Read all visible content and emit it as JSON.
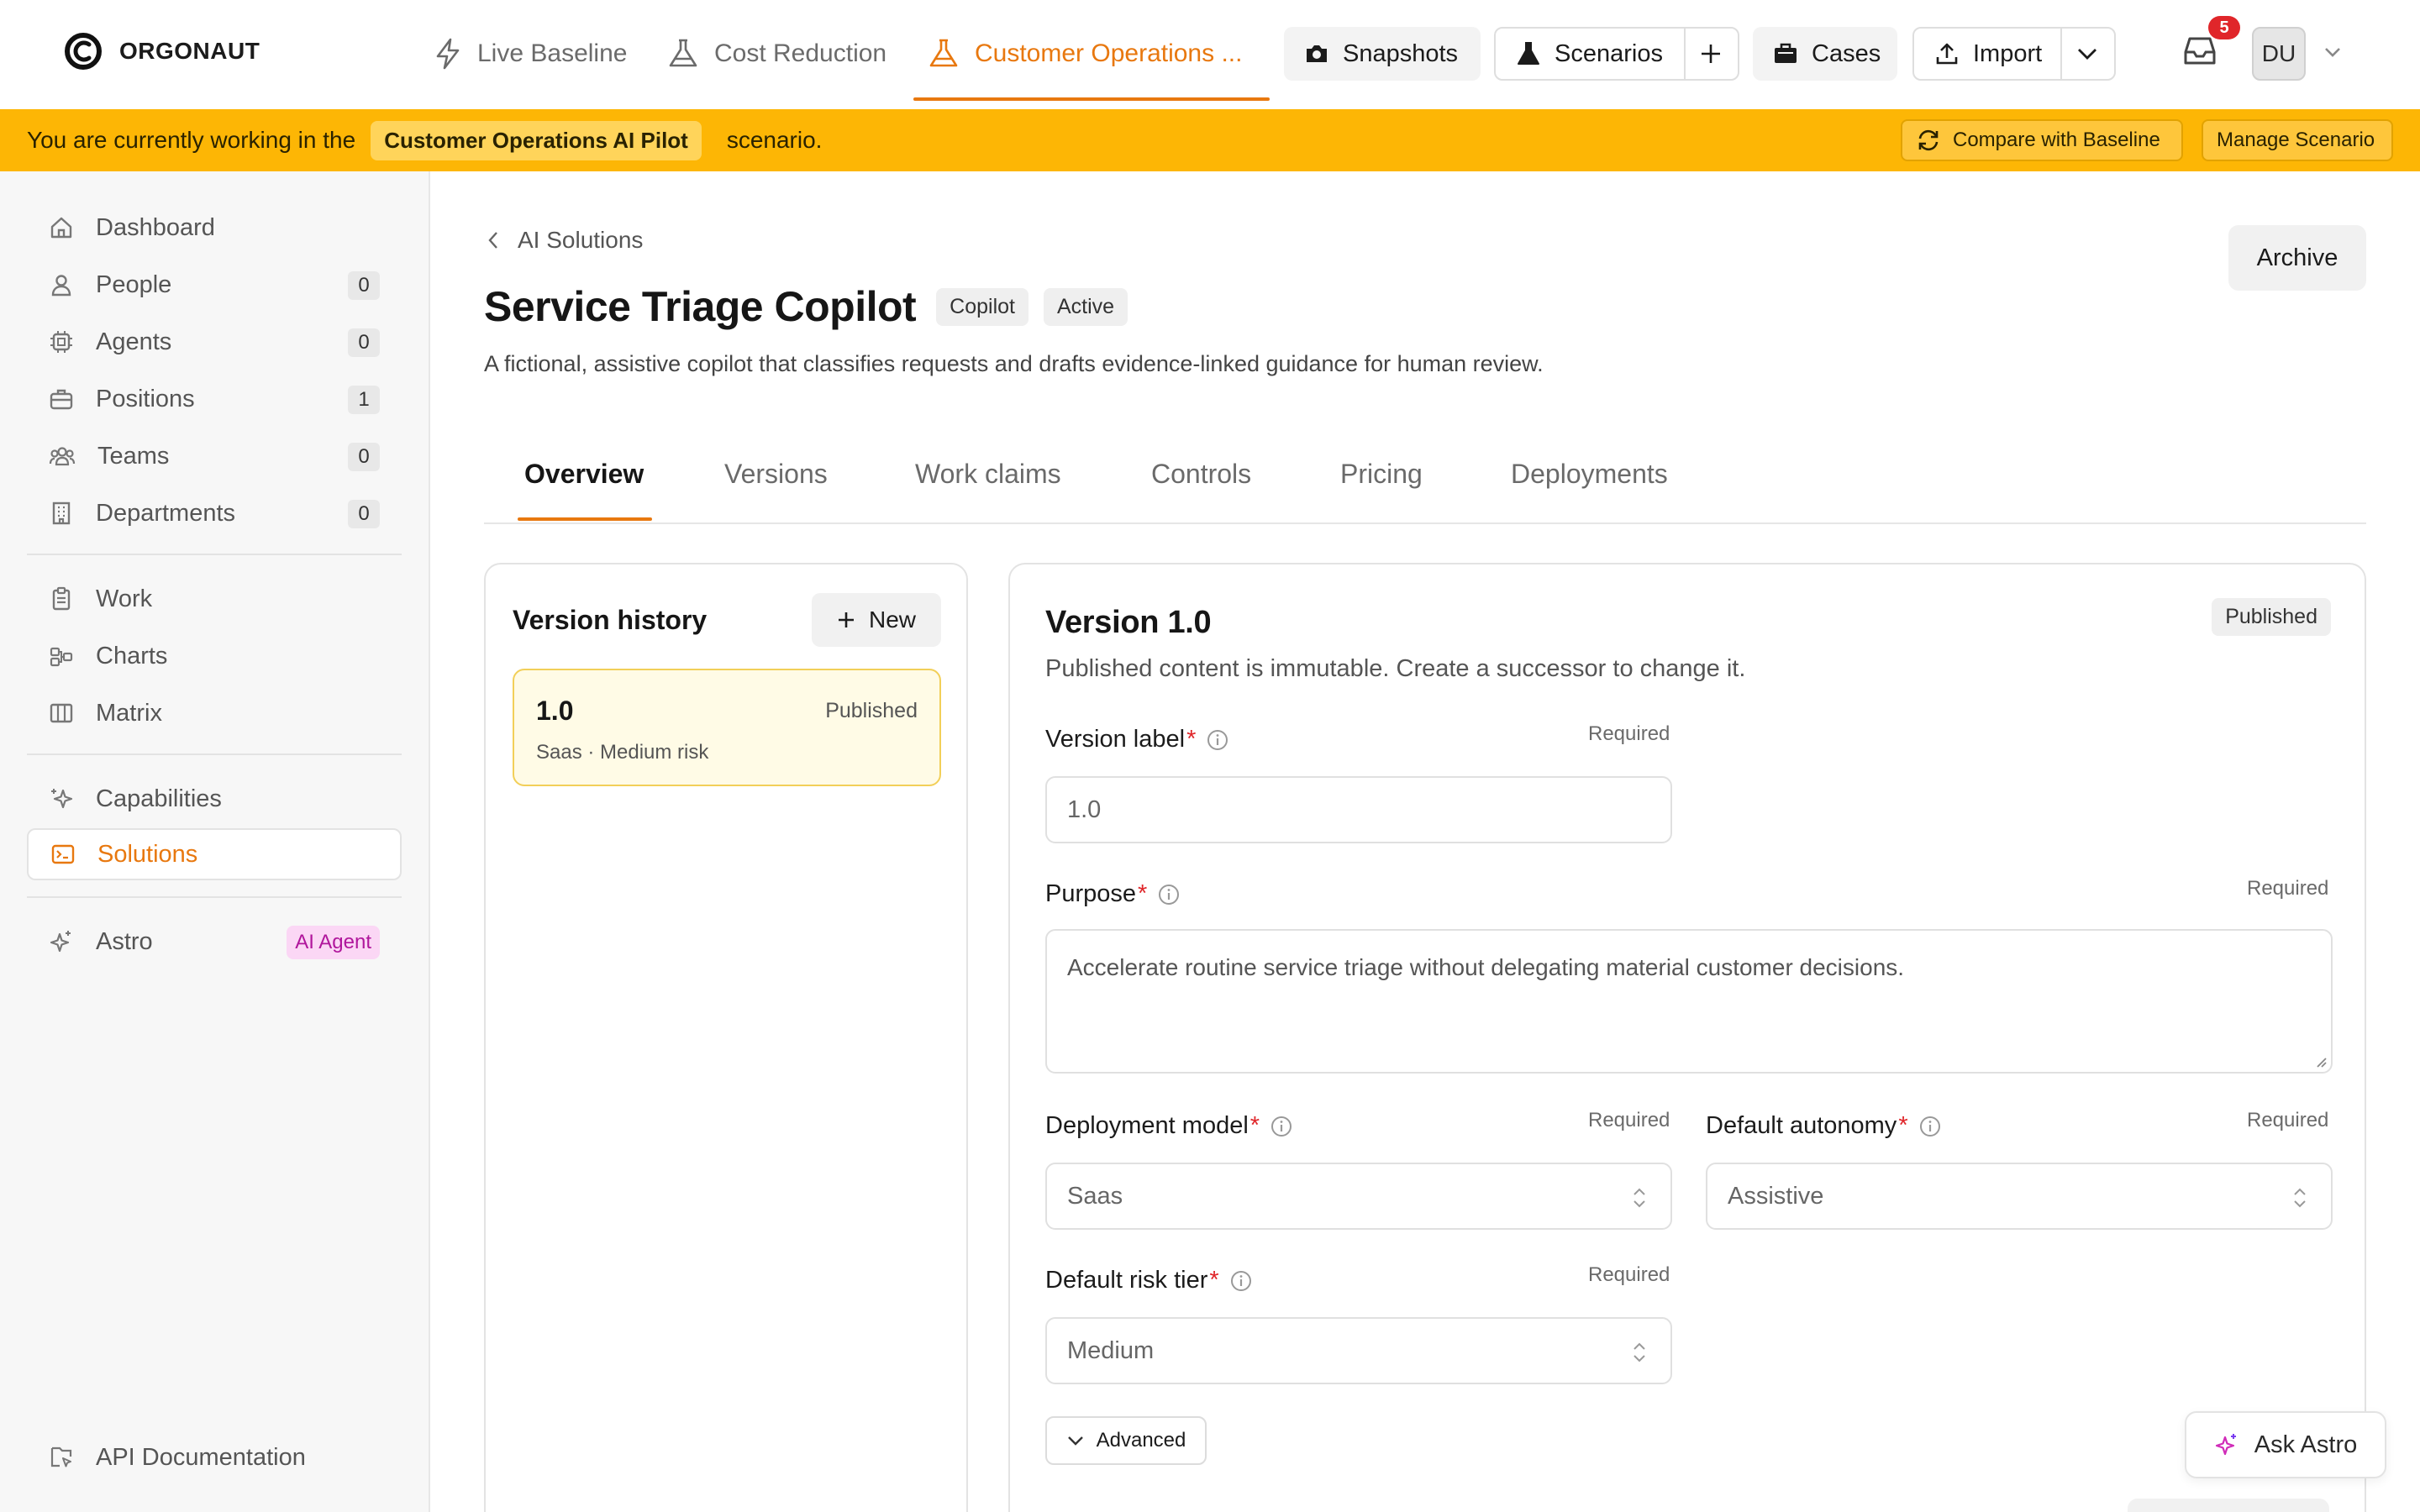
{
  "app": {
    "name": "ORGONAUT"
  },
  "nav": {
    "tabs": [
      {
        "label": "Live Baseline",
        "icon": "bolt-icon"
      },
      {
        "label": "Cost Reduction",
        "icon": "flask-icon"
      },
      {
        "label": "Customer Operations ...",
        "icon": "flask-icon",
        "active": true
      }
    ],
    "buttons": {
      "snapshots": "Snapshots",
      "scenarios": "Scenarios",
      "cases": "Cases",
      "import": "Import"
    },
    "inbox_count": "5",
    "user_initials": "DU"
  },
  "banner": {
    "prefix": "You are currently working in the",
    "scenario_name": "Customer Operations AI Pilot",
    "suffix": "scenario.",
    "compare_button": "Compare with Baseline",
    "manage_button": "Manage Scenario"
  },
  "sidebar": {
    "items": [
      {
        "label": "Dashboard"
      },
      {
        "label": "People",
        "count": "0"
      },
      {
        "label": "Agents",
        "count": "0"
      },
      {
        "label": "Positions",
        "count": "1"
      },
      {
        "label": "Teams",
        "count": "0"
      },
      {
        "label": "Departments",
        "count": "0"
      },
      {
        "label": "Work"
      },
      {
        "label": "Charts"
      },
      {
        "label": "Matrix"
      },
      {
        "label": "Capabilities"
      },
      {
        "label": "Solutions",
        "active": true
      },
      {
        "label": "Astro",
        "badge": "AI Agent"
      },
      {
        "label": "API Documentation"
      }
    ]
  },
  "page": {
    "breadcrumb": "AI Solutions",
    "title": "Service Triage Copilot",
    "tags": [
      "Copilot",
      "Active"
    ],
    "description": "A fictional, assistive copilot that classifies requests and drafts evidence-linked guidance for human review.",
    "archive_button": "Archive",
    "tabs": [
      "Overview",
      "Versions",
      "Work claims",
      "Controls",
      "Pricing",
      "Deployments"
    ],
    "active_tab": "Overview"
  },
  "version_history": {
    "title": "Version history",
    "new_button": "New",
    "items": [
      {
        "version": "1.0",
        "status": "Published",
        "meta": "Saas · Medium risk"
      }
    ]
  },
  "version_detail": {
    "title": "Version 1.0",
    "status": "Published",
    "note": "Published content is immutable. Create a successor to change it.",
    "required_text": "Required",
    "fields": {
      "version_label": {
        "label": "Version label",
        "value": "1.0"
      },
      "purpose": {
        "label": "Purpose",
        "value": "Accelerate routine service triage without delegating material customer decisions."
      },
      "deployment_model": {
        "label": "Deployment model",
        "value": "Saas"
      },
      "default_autonomy": {
        "label": "Default autonomy",
        "value": "Assistive"
      },
      "default_risk_tier": {
        "label": "Default risk tier",
        "value": "Medium"
      }
    },
    "advanced_button": "Advanced"
  },
  "ask_astro": "Ask Astro",
  "colors": {
    "accent": "#e8780f",
    "banner": "#fdb605",
    "required": "#e0262a",
    "selected_version_bg": "#fffbe6",
    "ai_badge_bg": "#fbd7f5",
    "ai_badge_text": "#b0169c"
  }
}
